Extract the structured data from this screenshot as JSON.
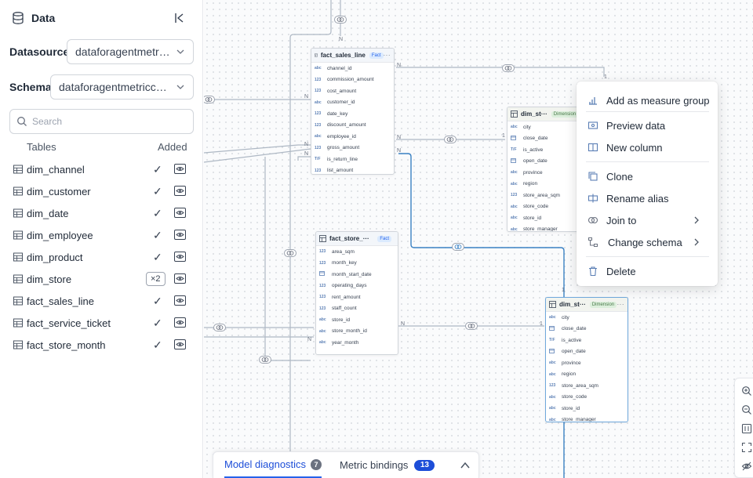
{
  "sidebar": {
    "title": "Data",
    "datasource_label": "Datasource",
    "datasource_value": "dataforagentmetric...",
    "schema_label": "Schema",
    "schema_value": "dataforagentmetriccha...",
    "search_placeholder": "Search",
    "col_tables": "Tables",
    "col_added": "Added",
    "tables": [
      {
        "name": "dim_channel",
        "status": "✓"
      },
      {
        "name": "dim_customer",
        "status": "✓"
      },
      {
        "name": "dim_date",
        "status": "✓"
      },
      {
        "name": "dim_employee",
        "status": "✓"
      },
      {
        "name": "dim_product",
        "status": "✓"
      },
      {
        "name": "dim_store",
        "badge": "×2"
      },
      {
        "name": "fact_sales_line",
        "status": "✓"
      },
      {
        "name": "fact_service_ticket",
        "status": "✓"
      },
      {
        "name": "fact_store_month",
        "status": "✓"
      }
    ]
  },
  "canvas": {
    "nodes": {
      "fact_sales_line": {
        "title": "fact_sales_line",
        "tag": "Fact",
        "more": "···",
        "columns": [
          {
            "type": "abc",
            "name": "channel_id"
          },
          {
            "type": "123",
            "name": "commission_amount"
          },
          {
            "type": "123",
            "name": "cost_amount"
          },
          {
            "type": "abc",
            "name": "customer_id"
          },
          {
            "type": "123",
            "name": "date_key"
          },
          {
            "type": "123",
            "name": "discount_amount"
          },
          {
            "type": "abc",
            "name": "employee_id"
          },
          {
            "type": "123",
            "name": "gross_amount"
          },
          {
            "type": "T/F",
            "name": "is_return_line"
          },
          {
            "type": "123",
            "name": "list_amount"
          }
        ]
      },
      "fact_store": {
        "title": "fact_store_···",
        "tag": "Fact",
        "columns": [
          {
            "type": "123",
            "name": "area_sqm"
          },
          {
            "type": "123",
            "name": "month_key"
          },
          {
            "type": "date",
            "name": "month_start_date"
          },
          {
            "type": "123",
            "name": "operating_days"
          },
          {
            "type": "123",
            "name": "rent_amount"
          },
          {
            "type": "123",
            "name": "staff_count"
          },
          {
            "type": "abc",
            "name": "store_id"
          },
          {
            "type": "abc",
            "name": "store_month_id"
          },
          {
            "type": "abc",
            "name": "year_month"
          }
        ]
      },
      "dim_store_top": {
        "title": "dim_st···",
        "tag": "Dimension",
        "columns": [
          {
            "type": "abc",
            "name": "city"
          },
          {
            "type": "date",
            "name": "close_date"
          },
          {
            "type": "T/F",
            "name": "is_active"
          },
          {
            "type": "date",
            "name": "open_date"
          },
          {
            "type": "abc",
            "name": "province"
          },
          {
            "type": "abc",
            "name": "region"
          },
          {
            "type": "123",
            "name": "store_area_sqm"
          },
          {
            "type": "abc",
            "name": "store_code"
          },
          {
            "type": "abc",
            "name": "store_id"
          },
          {
            "type": "abc",
            "name": "store_manager"
          }
        ]
      },
      "dim_store_bottom": {
        "title": "dim_st···",
        "tag": "Dimension",
        "more": "···",
        "columns": [
          {
            "type": "abc",
            "name": "city"
          },
          {
            "type": "date",
            "name": "close_date"
          },
          {
            "type": "T/F",
            "name": "is_active"
          },
          {
            "type": "date",
            "name": "open_date"
          },
          {
            "type": "abc",
            "name": "province"
          },
          {
            "type": "abc",
            "name": "region"
          },
          {
            "type": "123",
            "name": "store_area_sqm"
          },
          {
            "type": "abc",
            "name": "store_code"
          },
          {
            "type": "abc",
            "name": "store_id"
          },
          {
            "type": "abc",
            "name": "store_manager"
          }
        ]
      }
    },
    "cardinality": {
      "n": "N",
      "one": "1"
    }
  },
  "context_menu": {
    "items": [
      {
        "label": "Add as measure group",
        "icon": "measure-group-icon"
      },
      {
        "label": "Preview data",
        "icon": "preview-icon"
      },
      {
        "label": "New column",
        "icon": "new-column-icon"
      },
      {
        "label": "Clone",
        "icon": "clone-icon"
      },
      {
        "label": "Rename alias",
        "icon": "rename-icon"
      },
      {
        "label": "Join to",
        "icon": "join-icon",
        "submenu": true
      },
      {
        "label": "Change schema",
        "icon": "schema-icon",
        "submenu": true
      },
      {
        "label": "Delete",
        "icon": "trash-icon"
      }
    ]
  },
  "bottom_panel": {
    "tab1_label": "Model diagnostics",
    "tab1_count": "7",
    "tab2_label": "Metric bindings",
    "tab2_count": "13"
  },
  "colors": {
    "accent": "#1d4ed8",
    "fact_tag": "#dbeafe",
    "dimension_tag": "#dcefdc",
    "edge": "#aeb8c4",
    "edge_selected": "#3b82c4"
  }
}
